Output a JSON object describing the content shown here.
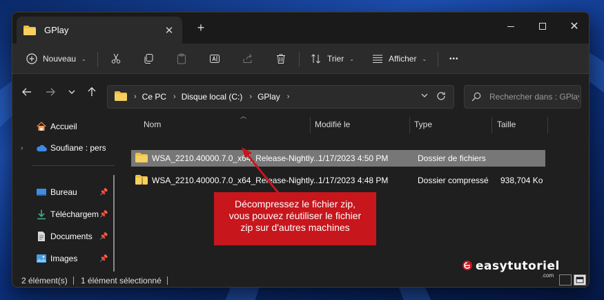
{
  "window": {
    "tab_title": "GPlay",
    "new_tab_symbol": "+",
    "tab_close_symbol": "✕"
  },
  "commandbar": {
    "new_label": "Nouveau",
    "sort_label": "Trier",
    "view_label": "Afficher",
    "more_label": "•••"
  },
  "address": {
    "crumbs": [
      "Ce PC",
      "Disque local (C:)",
      "GPlay"
    ],
    "search_placeholder": "Rechercher dans : GPlay"
  },
  "sidebar": {
    "items": [
      {
        "label": "Accueil"
      },
      {
        "label": "Soufiane : perso"
      },
      {
        "label": "Bureau"
      },
      {
        "label": "Téléchargem"
      },
      {
        "label": "Documents"
      },
      {
        "label": "Images"
      }
    ]
  },
  "filelist": {
    "columns": [
      "Nom",
      "Modifié le",
      "Type",
      "Taille"
    ],
    "rows": [
      {
        "name": "WSA_2210.40000.7.0_x64_Release-Nightly...",
        "modified": "1/17/2023 4:50 PM",
        "type": "Dossier de fichiers",
        "size": "",
        "selected": true
      },
      {
        "name": "WSA_2210.40000.7.0_x64_Release-Nightly...",
        "modified": "1/17/2023 4:48 PM",
        "type": "Dossier compressé",
        "size": "938,704 Ko",
        "selected": false
      }
    ]
  },
  "status": {
    "count": "2 élément(s)",
    "selection": "1 élément sélectionné"
  },
  "annotation": {
    "line1": "Décompressez le fichier zip,",
    "line2": "vous pouvez réutiliser le fichier",
    "line3": "zip sur d'autres machines",
    "color": "#c8161d"
  },
  "brand": {
    "name": "easytutoriel",
    "suffix": ".com"
  },
  "colors": {
    "folder": "#f0c040",
    "selection": "#777777",
    "accent_blue": "#4aa0ff"
  }
}
